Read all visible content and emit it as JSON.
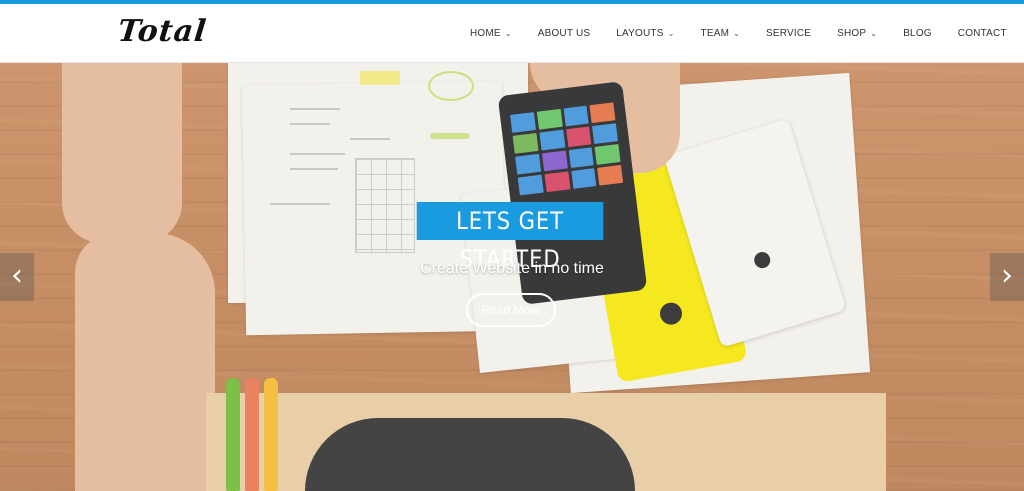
{
  "header": {
    "logo": "Total",
    "nav": [
      {
        "label": "HOME",
        "has_dropdown": true,
        "icon": "chevron-down-icon"
      },
      {
        "label": "ABOUT US",
        "has_dropdown": false
      },
      {
        "label": "LAYOUTS",
        "has_dropdown": true,
        "icon": "chevron-down-icon"
      },
      {
        "label": "TEAM",
        "has_dropdown": true,
        "icon": "chevron-down-icon"
      },
      {
        "label": "SERVICE",
        "has_dropdown": false
      },
      {
        "label": "SHOP",
        "has_dropdown": true,
        "icon": "chevron-down-icon"
      },
      {
        "label": "BLOG",
        "has_dropdown": false
      },
      {
        "label": "CONTACT",
        "has_dropdown": false
      }
    ]
  },
  "hero": {
    "title": "LETS GET STARTED",
    "subtitle": "Create Website in no time",
    "button": "Read More",
    "prev_icon": "chevron-left-icon",
    "next_icon": "chevron-right-icon"
  },
  "colors": {
    "accent": "#1a9be0",
    "header_bg": "#ffffff",
    "text": "#333333"
  }
}
